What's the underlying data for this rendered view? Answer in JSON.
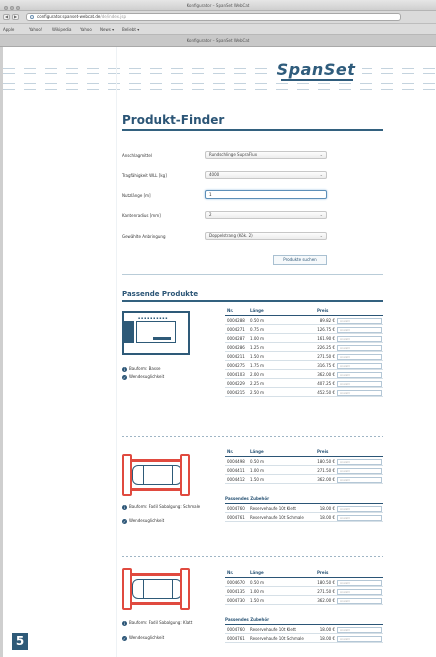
{
  "window": {
    "title": "Konfigurator – SpanSet WebCat"
  },
  "toolbar": {
    "url": "configurator.spanset-webcat.de",
    "url_hint": "/de/index.jsp",
    "back": "◀",
    "fwd": "▶"
  },
  "bookmarks": [
    "Apple",
    "Yahoo!",
    "Wikipedia",
    "Yahoo",
    "News ▾",
    "Beliebt ▾"
  ],
  "tab_title": "Konfigurator – SpanSet WebCat",
  "logo": "SpanSet",
  "finder": {
    "title": "Produkt-Finder",
    "fields": [
      {
        "label": "Anschlagmittel",
        "value": "Rundschlinge SupraFlux",
        "kind": "select"
      },
      {
        "label": "Tragfähigkeit WLL [kg]",
        "value": "4000",
        "kind": "select"
      },
      {
        "label": "Nutzlänge [m]",
        "value": "1",
        "kind": "input"
      },
      {
        "label": "Kantenradius [mm]",
        "value": "2",
        "kind": "select"
      },
      {
        "label": "Gewählte Anbringung",
        "value": "Doppelstrang (Kök. 2)",
        "kind": "select"
      }
    ],
    "search_label": "Produkte suchen"
  },
  "results": {
    "title": "Passende Produkte",
    "qty_placeholder": "Anzahl",
    "headers": {
      "nr": "Nr.",
      "length": "Länge",
      "price": "Preis"
    },
    "groups": [
      {
        "notes": [
          "Bauform: Basse",
          "Wendesuglichkeit"
        ],
        "rows": [
          [
            "0004288",
            "0.50 m",
            "89.82 €"
          ],
          [
            "0004271",
            "0.75 m",
            "126.75 €"
          ],
          [
            "0004287",
            "1.00 m",
            "161.90 €"
          ],
          [
            "0004286",
            "1.25 m",
            "226.25 €"
          ],
          [
            "0004211",
            "1.50 m",
            "271.50 €"
          ],
          [
            "0004275",
            "1.75 m",
            "316.75 €"
          ],
          [
            "0004103",
            "2.00 m",
            "362.00 €"
          ],
          [
            "0004229",
            "2.25 m",
            "407.25 €"
          ],
          [
            "0004215",
            "2.50 m",
            "452.50 €"
          ]
        ]
      },
      {
        "notes": [
          "Bauform: Fadil Sabalgung: Schmale",
          "Wendesuglichkeit"
        ],
        "rows": [
          [
            "0004498",
            "0.50 m",
            "180.50 €"
          ],
          [
            "0004411",
            "1.00 m",
            "271.50 €"
          ],
          [
            "0004412",
            "1.50 m",
            "362.00 €"
          ]
        ],
        "accessory_title": "Passendes Zubehör",
        "accessories": [
          [
            "0004760",
            "Reservehaufe 10t Klett",
            "18.00 €"
          ],
          [
            "0004761",
            "Reservehaufe 10t Schmale",
            "18.00 €"
          ]
        ]
      },
      {
        "notes": [
          "Bauform: Fadil Sabalgung: Klatt",
          "Wendesuglichkeit"
        ],
        "rows": [
          [
            "0004670",
            "0.50 m",
            "180.50 €"
          ],
          [
            "0004135",
            "1.00 m",
            "271.50 €"
          ],
          [
            "0004730",
            "1.50 m",
            "362.00 €"
          ]
        ],
        "accessory_title": "Passendes Zubehör",
        "accessories": [
          [
            "0004760",
            "Reservehaufe 10t Klett",
            "18.00 €"
          ],
          [
            "0004761",
            "Reservehaufe 10t Schmale",
            "18.00 €"
          ]
        ]
      }
    ]
  },
  "badge": "5",
  "colors": {
    "brand": "#2b5576",
    "accent": "#e04a3f"
  }
}
